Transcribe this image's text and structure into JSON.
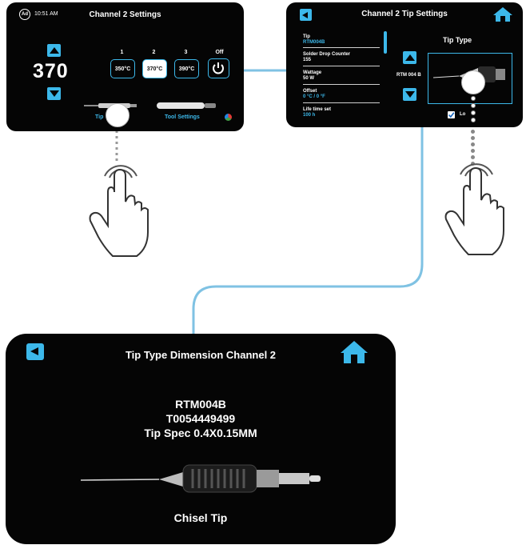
{
  "screen1": {
    "ad_badge": "Ad",
    "time": "10:51 AM",
    "title": "Channel 2 Settings",
    "temperature": "370",
    "presets": [
      {
        "label": "1",
        "value": "350°C"
      },
      {
        "label": "2",
        "value": "370°C"
      },
      {
        "label": "3",
        "value": "390°C"
      }
    ],
    "off_label": "Off",
    "tip_button": "Tip",
    "tool_settings_button": "Tool Settings"
  },
  "screen2": {
    "title": "Channel 2 Tip Settings",
    "list": [
      {
        "key": "Tip",
        "value": "RTM004B"
      },
      {
        "key": "Solder Drop Counter",
        "value": "155"
      },
      {
        "key": "Wattage",
        "value": "50 W"
      },
      {
        "key": "Offset",
        "value": "0 °C / 0 °F"
      },
      {
        "key": "Life time set",
        "value": "100 h"
      }
    ],
    "tip_type_heading": "Tip Type",
    "selected_tip": "RTM 004 B",
    "lock_label": "Lo"
  },
  "screen3": {
    "title": "Tip Type Dimension Channel 2",
    "model": "RTM004B",
    "part_number": "T0054449499",
    "spec": "Tip Spec 0.4X0.15MM",
    "tip_shape": "Chisel Tip"
  },
  "colors": {
    "accent": "#3cb8ea",
    "screen_bg": "#050505",
    "connector": "#7fc2e3"
  },
  "icons": [
    "back-icon",
    "home-icon",
    "power-icon",
    "up-arrow-icon",
    "down-arrow-icon",
    "hand-pointer-icon",
    "color-wheel-icon",
    "soldering-tip-icon"
  ]
}
